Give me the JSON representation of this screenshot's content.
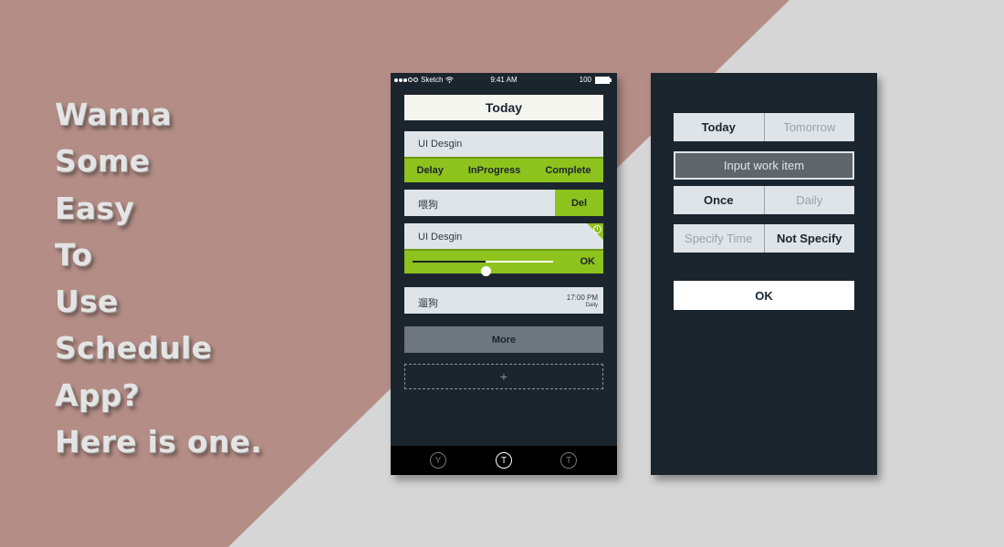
{
  "headline": [
    "Wanna",
    "Some",
    "Easy",
    "To",
    "Use",
    "Schedule",
    "App?",
    "Here is one."
  ],
  "colors": {
    "accent": "#8ec21d",
    "panel": "#1b252e",
    "card": "#dfe4e8",
    "background_left": "#b48e86",
    "background_right": "#d6d6d6"
  },
  "phone1": {
    "status": {
      "carrier": "Sketch",
      "time": "9:41 AM",
      "battery": "100"
    },
    "today_title": "Today",
    "tasks": [
      {
        "label": "UI Desgin",
        "actions": [
          "Delay",
          "InProgress",
          "Complete"
        ]
      },
      {
        "label": "喂狗",
        "action": "Del"
      },
      {
        "label": "UI Desgin",
        "progress": 0.52,
        "action": "OK",
        "icon": "clock-icon"
      },
      {
        "label": "遛狗",
        "time": "17:00 PM",
        "repeat": "Daily"
      }
    ],
    "more_label": "More",
    "add_label": "+",
    "tabs": [
      "Y",
      "T",
      "T"
    ]
  },
  "phone2": {
    "day_options": [
      "Today",
      "Tomorrow"
    ],
    "input_placeholder": "Input work item",
    "repeat_options": [
      "Once",
      "Daily"
    ],
    "time_options": [
      "Specify Time",
      "Not Specify"
    ],
    "ok_label": "OK"
  }
}
